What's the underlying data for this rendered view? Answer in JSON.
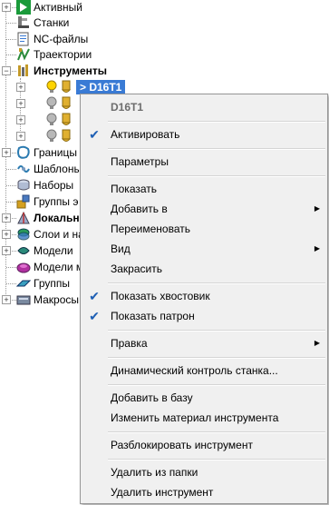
{
  "tree": {
    "items": [
      {
        "label": "Активный",
        "icon": "active-arrow-icon",
        "bold": false,
        "expandable": true
      },
      {
        "label": "Станки",
        "icon": "machine-icon",
        "bold": false,
        "expandable": false
      },
      {
        "label": "NC-файлы",
        "icon": "nc-file-icon",
        "bold": false,
        "expandable": false
      },
      {
        "label": "Траектории",
        "icon": "toolpath-icon",
        "bold": false,
        "expandable": false
      },
      {
        "label": "Инструменты",
        "icon": "tools-icon",
        "bold": true,
        "expandable": true
      },
      {
        "label": "Границы",
        "icon": "boundary-icon",
        "bold": false,
        "expandable": true
      },
      {
        "label": "Шаблоны",
        "icon": "pattern-icon",
        "bold": false,
        "expandable": false
      },
      {
        "label": "Наборы",
        "icon": "feature-set-icon",
        "bold": false,
        "expandable": false
      },
      {
        "label": "Группы э",
        "icon": "group-icon",
        "bold": false,
        "expandable": false
      },
      {
        "label": "Локальн",
        "icon": "workplane-icon",
        "bold": true,
        "expandable": true
      },
      {
        "label": "Слои и на",
        "icon": "layers-icon",
        "bold": false,
        "expandable": true
      },
      {
        "label": "Модели",
        "icon": "model-icon",
        "bold": false,
        "expandable": true
      },
      {
        "label": "Модели м",
        "icon": "stock-model-icon",
        "bold": false,
        "expandable": false
      },
      {
        "label": "Группы",
        "icon": "groups-icon",
        "bold": false,
        "expandable": false
      },
      {
        "label": "Макросы",
        "icon": "macro-icon",
        "bold": false,
        "expandable": true
      }
    ],
    "selected_tool": "> D16T1",
    "tool_rows": 4
  },
  "menu": {
    "header": "D16T1",
    "items": [
      {
        "label": "Активировать",
        "checked": true,
        "submenu": false
      },
      {
        "label": "Параметры",
        "checked": false,
        "submenu": false
      },
      {
        "label": "Показать",
        "checked": false,
        "submenu": false
      },
      {
        "label": "Добавить в",
        "checked": false,
        "submenu": true
      },
      {
        "label": "Переименовать",
        "checked": false,
        "submenu": false
      },
      {
        "label": "Вид",
        "checked": false,
        "submenu": true
      },
      {
        "label": "Закрасить",
        "checked": false,
        "submenu": false
      },
      {
        "label": "Показать хвостовик",
        "checked": true,
        "submenu": false
      },
      {
        "label": "Показать патрон",
        "checked": true,
        "submenu": false
      },
      {
        "label": "Правка",
        "checked": false,
        "submenu": true
      },
      {
        "label": "Динамический контроль станка...",
        "checked": false,
        "submenu": false
      },
      {
        "label": "Добавить в базу",
        "checked": false,
        "submenu": false
      },
      {
        "label": "Изменить материал инструмента",
        "checked": false,
        "submenu": false
      },
      {
        "label": "Разблокировать инструмент",
        "checked": false,
        "submenu": false
      },
      {
        "label": "Удалить из папки",
        "checked": false,
        "submenu": false
      },
      {
        "label": "Удалить инструмент",
        "checked": false,
        "submenu": false
      }
    ]
  },
  "colors": {
    "selection": "#3a7bd5",
    "checkmark": "#1e5fb4",
    "menu_bg": "#f0f0f0"
  }
}
